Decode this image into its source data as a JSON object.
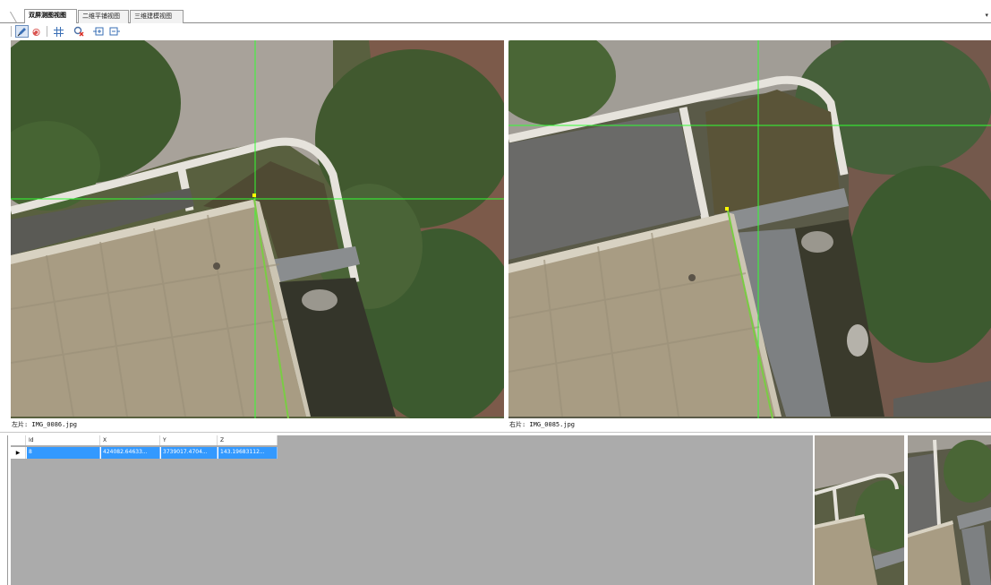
{
  "tabs": [
    {
      "label": "双屏测图视图",
      "active": true
    },
    {
      "label": "二维平铺视图",
      "active": false
    },
    {
      "label": "三维建模视图",
      "active": false
    }
  ],
  "toolbar": {
    "icons": [
      "pen-icon",
      "undo-icon",
      "grid-icon",
      "delete-point-icon",
      "zoom-in-icon",
      "zoom-out-icon"
    ]
  },
  "left_view": {
    "caption": "左片: IMG_0086.jpg"
  },
  "right_view": {
    "caption": "右片: IMG_0085.jpg"
  },
  "grid": {
    "columns": [
      "Id",
      "X",
      "Y",
      "Z"
    ],
    "rows": [
      {
        "id": "8",
        "x": "424082.64633...",
        "y": "3739017.4704...",
        "z": "143.19683112..."
      }
    ],
    "selection_color": "#3399ff"
  },
  "colors": {
    "crosshair": "#33ff33",
    "marker": "#ffff00",
    "grid_background": "#ababab"
  }
}
